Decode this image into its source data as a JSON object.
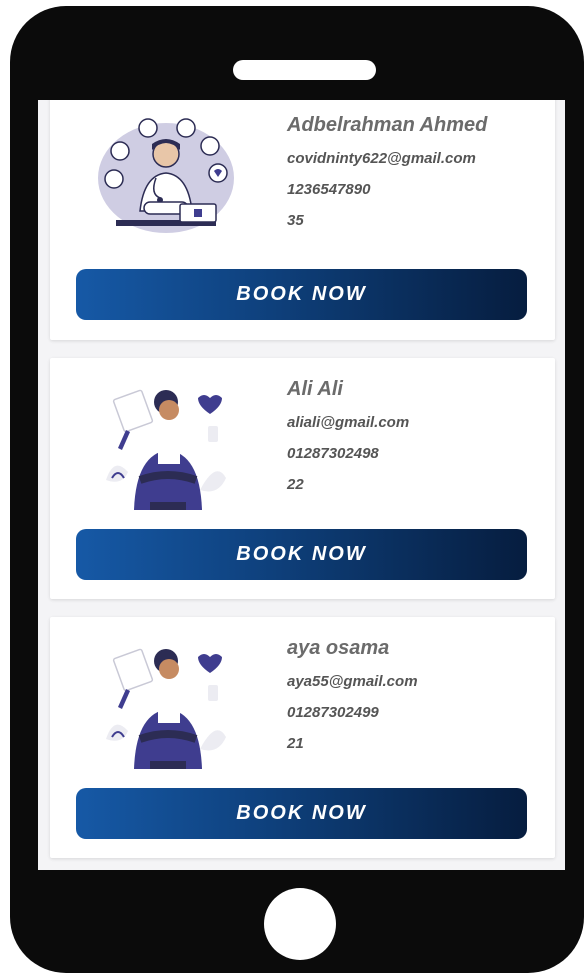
{
  "doctors": [
    {
      "name": "Adbelrahman Ahmed",
      "email": "covidninty622@gmail.com",
      "phone": "1236547890",
      "age": "35",
      "button_label": "BOOK NOW",
      "avatar_icon": "male-doctor-illustration"
    },
    {
      "name": "Ali Ali",
      "email": "aliali@gmail.com",
      "phone": "01287302498",
      "age": "22",
      "button_label": "BOOK NOW",
      "avatar_icon": "female-doctor-illustration"
    },
    {
      "name": "aya osama",
      "email": "aya55@gmail.com",
      "phone": "01287302499",
      "age": "21",
      "button_label": "BOOK NOW",
      "avatar_icon": "female-doctor-illustration"
    }
  ],
  "colors": {
    "button_start": "#1659a6",
    "button_end": "#061d3f",
    "phone_frame": "#0b0b0b",
    "illustration_accent": "#3f3d8f"
  }
}
